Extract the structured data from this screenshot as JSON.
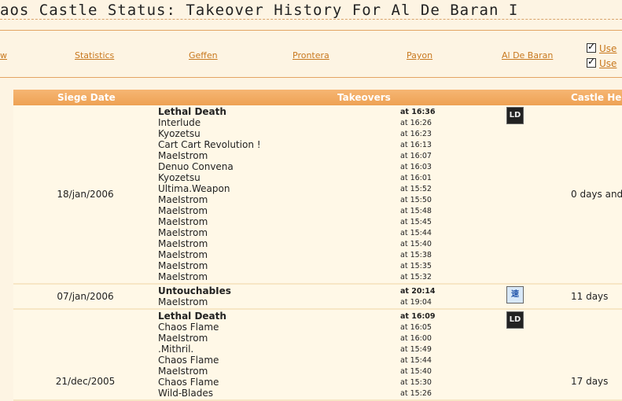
{
  "page": {
    "title": "aos Castle Status: Takeover History For Al De Baran I"
  },
  "nav": {
    "links": [
      "w",
      "Statistics",
      "Geffen",
      "Prontera",
      "Payon",
      "Al De Baran"
    ],
    "options": [
      "Use",
      "Use"
    ]
  },
  "table": {
    "headers": [
      "Siege Date",
      "Takeovers",
      "Castle Hel"
    ],
    "rows": [
      {
        "date": "18/jan/2006",
        "held": "0 days and",
        "emblem": "LD",
        "takeovers": [
          {
            "guild": "Lethal Death",
            "time": "at 16:36"
          },
          {
            "guild": "Interlude",
            "time": "at 16:26"
          },
          {
            "guild": "Kyozetsu",
            "time": "at 16:23"
          },
          {
            "guild": "Cart Cart Revolution !",
            "time": "at 16:13"
          },
          {
            "guild": "MaeIstrom",
            "time": "at 16:07"
          },
          {
            "guild": "Denuo Convena",
            "time": "at 16:03"
          },
          {
            "guild": "Kyozetsu",
            "time": "at 16:01"
          },
          {
            "guild": "Ultima.Weapon",
            "time": "at 15:52"
          },
          {
            "guild": "MaeIstrom",
            "time": "at 15:50"
          },
          {
            "guild": "Maelstrom",
            "time": "at 15:48"
          },
          {
            "guild": "MaeIstrom",
            "time": "at 15:45"
          },
          {
            "guild": "Maelstrom",
            "time": "at 15:44"
          },
          {
            "guild": "MaeIstrom",
            "time": "at 15:40"
          },
          {
            "guild": "Maelstrom",
            "time": "at 15:38"
          },
          {
            "guild": "MaeIstrom",
            "time": "at 15:35"
          },
          {
            "guild": "Maelstrom",
            "time": "at 15:32"
          }
        ]
      },
      {
        "date": "07/jan/2006",
        "held": "11 days",
        "emblem": "速",
        "takeovers": [
          {
            "guild": "UntouchabIes",
            "time": "at 20:14"
          },
          {
            "guild": "MaeIstrom",
            "time": "at 19:04"
          }
        ]
      },
      {
        "date": "21/dec/2005",
        "held": "17 days",
        "emblem": "LD",
        "takeovers": [
          {
            "guild": "Lethal Death",
            "time": "at 16:09"
          },
          {
            "guild": "Chaos Flame",
            "time": "at 16:05"
          },
          {
            "guild": "MaeIstrom",
            "time": "at 16:00"
          },
          {
            "guild": ".Mithril.",
            "time": "at 15:49"
          },
          {
            "guild": "Chaos Flame",
            "time": "at 15:44"
          },
          {
            "guild": "MaeIstrom",
            "time": "at 15:40"
          },
          {
            "guild": "Chaos Flame",
            "time": "at 15:30"
          },
          {
            "guild": "Wild-Blades",
            "time": "at 15:26"
          }
        ]
      }
    ]
  }
}
